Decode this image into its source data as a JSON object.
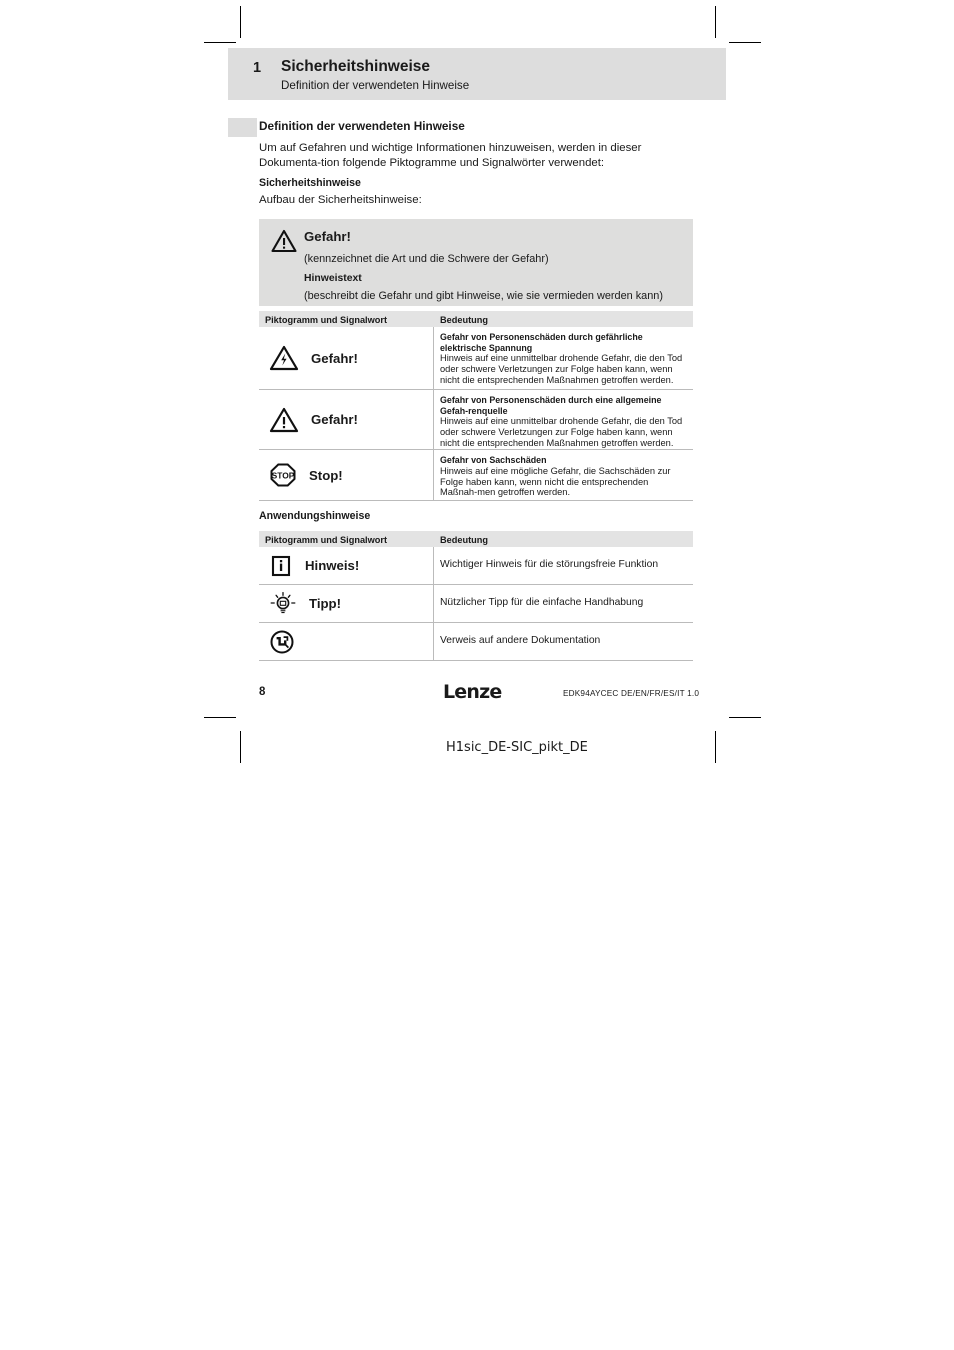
{
  "header": {
    "chapter_number": "1",
    "chapter_title": "Sicherheitshinweise",
    "chapter_subtitle": "Definition der verwendeten Hinweise"
  },
  "section": {
    "title": "Definition der verwendeten Hinweise",
    "intro_paragraph": "Um auf Gefahren und wichtige Informationen hinzuweisen, werden in dieser Dokumenta-tion folgende Piktogramme und Signalwörter verwendet:",
    "safety_heading": "Sicherheitshinweise",
    "safety_lead": "Aufbau der Sicherheitshinweise:"
  },
  "notice_box": {
    "icon": "warning-triangle-icon",
    "signal_word": "Gefahr!",
    "line_1": "(kennzeichnet die Art und die Schwere der Gefahr)",
    "line_2": "Hinweistext",
    "line_3": "(beschreibt die Gefahr und gibt Hinweise, wie sie vermieden werden kann)"
  },
  "safety_table": {
    "columns": [
      "Piktogramm und Signalwort",
      "Bedeutung"
    ],
    "rows": [
      {
        "icon": "warning-triangle-lightning-icon",
        "signal_word": "Gefahr!",
        "meaning_title": "Gefahr von Personenschäden durch gefährliche elektrische Spannung",
        "meaning_body": "Hinweis auf eine unmittelbar drohende Gefahr, die den Tod oder schwere Verletzungen zur Folge haben kann, wenn nicht die entsprechenden Maßnahmen getroffen werden."
      },
      {
        "icon": "warning-triangle-exclamation-icon",
        "signal_word": "Gefahr!",
        "meaning_title": "Gefahr von Personenschäden durch eine allgemeine Gefah-renquelle",
        "meaning_body": "Hinweis auf eine unmittelbar drohende Gefahr, die den Tod oder schwere Verletzungen zur Folge haben kann, wenn nicht die entsprechenden Maßnahmen getroffen werden."
      },
      {
        "icon": "stop-octagon-icon",
        "signal_word": "Stop!",
        "meaning_title": "Gefahr von Sachschäden",
        "meaning_body": "Hinweis auf eine mögliche Gefahr, die Sachschäden zur Folge haben kann, wenn nicht die entsprechenden Maßnah-men getroffen werden."
      }
    ]
  },
  "application_heading": "Anwendungshinweise",
  "application_table": {
    "columns": [
      "Piktogramm und Signalwort",
      "Bedeutung"
    ],
    "rows": [
      {
        "icon": "info-square-icon",
        "signal_word": "Hinweis!",
        "meaning": "Wichtiger Hinweis für die störungsfreie Funktion"
      },
      {
        "icon": "lightbulb-tip-icon",
        "signal_word": "Tipp!",
        "meaning": "Nützlicher Tipp für die einfache Handhabung"
      },
      {
        "icon": "documentation-reference-icon",
        "signal_word": "",
        "meaning": "Verweis auf andere Dokumentation"
      }
    ]
  },
  "footer": {
    "page_number": "8",
    "brand": "Lenze",
    "document_code": "EDK94AYCEC  DE/EN/FR/ES/IT  1.0",
    "file_reference": "H1sic_DE-SIC_pikt_DE"
  },
  "colors": {
    "band_gray": "#dddddd",
    "notice_gray": "#dededd",
    "table_header_gray": "#e3e3e3",
    "rule_gray": "#bbbbbb",
    "text": "#1a1a1a"
  }
}
